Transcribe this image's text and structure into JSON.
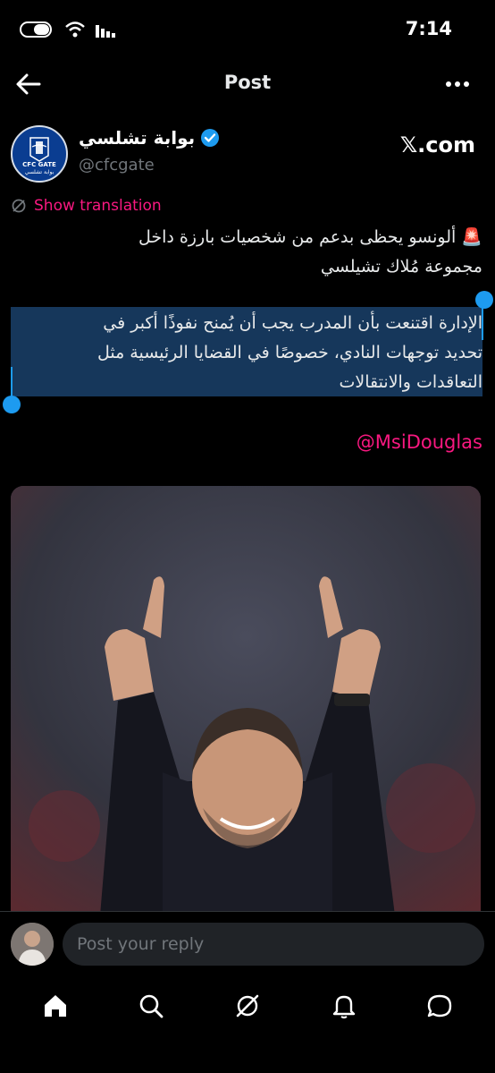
{
  "status_bar": {
    "time": "7:14"
  },
  "topbar": {
    "title": "Post"
  },
  "author": {
    "name": "بوابة تشلسي",
    "handle": "@cfcgate",
    "verified": true,
    "avatar_text": "CFC GATE",
    "avatar_subtext": "بوابة تشلسي"
  },
  "watermark": {
    "text": "𝕏.com"
  },
  "translation": {
    "label": "Show translation"
  },
  "tweet": {
    "line1": "🚨 ألونسو يحظى بدعم من شخصيات بارزة داخل",
    "line2": "مجموعة مُلاك تشيلسي",
    "line3": "الإدارة اقتنعت بأن المدرب يجب أن يُمنح نفوذًا أكبر في",
    "line4": "تحديد توجهات النادي، خصوصًا في القضايا الرئيسية مثل",
    "line5": "التعاقدات والانتقالات",
    "mention": "@MsiDouglas"
  },
  "reply": {
    "placeholder": "Post your reply"
  },
  "colors": {
    "accent": "#1d9bf0",
    "pink": "#f91880",
    "background": "#000000"
  },
  "nav": [
    "home-icon",
    "search-icon",
    "grok-icon",
    "notifications-icon",
    "messages-icon"
  ]
}
